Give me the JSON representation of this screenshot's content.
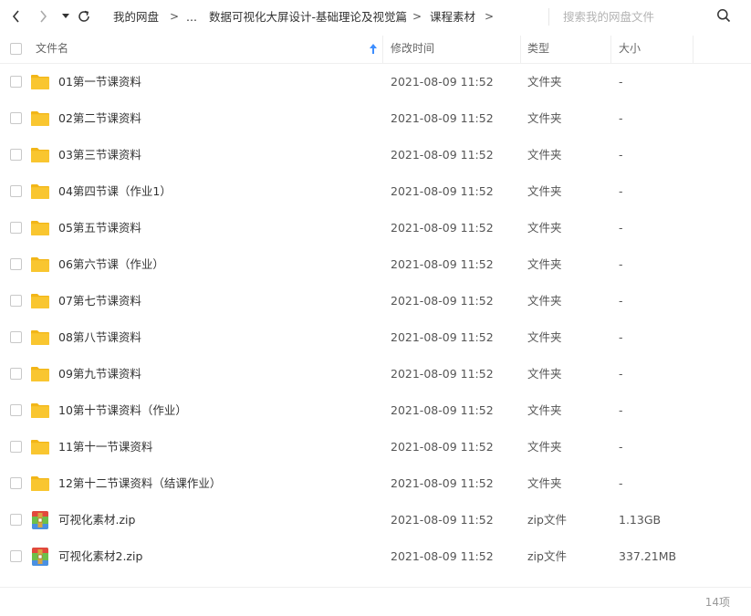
{
  "toolbar": {
    "breadcrumb": [
      "我的网盘",
      "...",
      "数据可视化大屏设计-基础理论及视觉篇",
      "课程素材"
    ],
    "separator": ">",
    "search_placeholder": "搜索我的网盘文件",
    "icons": {
      "back": "chevron-left-icon",
      "forward": "chevron-right-icon",
      "history": "caret-down-icon",
      "refresh": "refresh-icon",
      "search": "search-icon"
    }
  },
  "columns": {
    "name": "文件名",
    "modified": "修改时间",
    "type": "类型",
    "size": "大小"
  },
  "files": [
    {
      "name": "01第一节课资料",
      "modified": "2021-08-09 11:52",
      "type": "文件夹",
      "size": "-",
      "icon": "folder-icon"
    },
    {
      "name": "02第二节课资料",
      "modified": "2021-08-09 11:52",
      "type": "文件夹",
      "size": "-",
      "icon": "folder-icon"
    },
    {
      "name": "03第三节课资料",
      "modified": "2021-08-09 11:52",
      "type": "文件夹",
      "size": "-",
      "icon": "folder-icon"
    },
    {
      "name": "04第四节课（作业1）",
      "modified": "2021-08-09 11:52",
      "type": "文件夹",
      "size": "-",
      "icon": "folder-icon"
    },
    {
      "name": "05第五节课资料",
      "modified": "2021-08-09 11:52",
      "type": "文件夹",
      "size": "-",
      "icon": "folder-icon"
    },
    {
      "name": "06第六节课（作业）",
      "modified": "2021-08-09 11:52",
      "type": "文件夹",
      "size": "-",
      "icon": "folder-icon"
    },
    {
      "name": "07第七节课资料",
      "modified": "2021-08-09 11:52",
      "type": "文件夹",
      "size": "-",
      "icon": "folder-icon"
    },
    {
      "name": "08第八节课资料",
      "modified": "2021-08-09 11:52",
      "type": "文件夹",
      "size": "-",
      "icon": "folder-icon"
    },
    {
      "name": "09第九节课资料",
      "modified": "2021-08-09 11:52",
      "type": "文件夹",
      "size": "-",
      "icon": "folder-icon"
    },
    {
      "name": "10第十节课资料（作业）",
      "modified": "2021-08-09 11:52",
      "type": "文件夹",
      "size": "-",
      "icon": "folder-icon"
    },
    {
      "name": "11第十一节课资料",
      "modified": "2021-08-09 11:52",
      "type": "文件夹",
      "size": "-",
      "icon": "folder-icon"
    },
    {
      "name": "12第十二节课资料（结课作业）",
      "modified": "2021-08-09 11:52",
      "type": "文件夹",
      "size": "-",
      "icon": "folder-icon"
    },
    {
      "name": "可视化素材.zip",
      "modified": "2021-08-09 11:52",
      "type": "zip文件",
      "size": "1.13GB",
      "icon": "zip-archive-icon"
    },
    {
      "name": "可视化素材2.zip",
      "modified": "2021-08-09 11:52",
      "type": "zip文件",
      "size": "337.21MB",
      "icon": "zip-archive-icon"
    }
  ],
  "footer": {
    "count": "14项"
  },
  "colors": {
    "folder": "#f9c630",
    "folder_tab": "#f2b618",
    "sort_arrow": "#3d8eff",
    "zip_red": "#e2483d",
    "zip_green": "#6cc04a",
    "zip_blue": "#4a90e2"
  }
}
